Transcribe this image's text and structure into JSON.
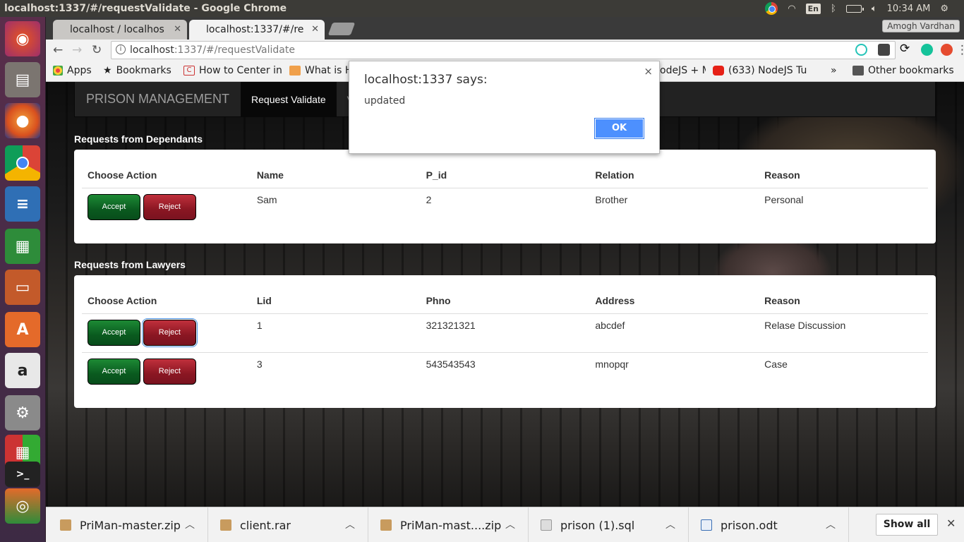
{
  "system": {
    "window_title": "localhost:1337/#/requestValidate - Google Chrome",
    "keyboard": "En",
    "time": "10:34 AM"
  },
  "browser": {
    "tabs": [
      {
        "label": "localhost / localhos"
      },
      {
        "label": "localhost:1337/#/re"
      }
    ],
    "profile": "Amogh Vardhan",
    "url_host": "localhost",
    "url_path": ":1337/#/requestValidate",
    "bookmarks": [
      "Apps",
      "Bookmarks",
      "How to Center in",
      "What is H",
      "odeJS + M",
      "(633) NodeJS Tu"
    ],
    "overflow": "»",
    "other_bookmarks": "Other bookmarks"
  },
  "app": {
    "brand": "PRISON MANAGEMENT",
    "nav": [
      "Request Validate",
      "V"
    ],
    "dependants": {
      "title": "Requests from Dependants",
      "headers": [
        "Choose Action",
        "Name",
        "P_id",
        "Relation",
        "Reason"
      ],
      "rows": [
        [
          "Sam",
          "2",
          "Brother",
          "Personal"
        ]
      ]
    },
    "lawyers": {
      "title": "Requests from Lawyers",
      "headers": [
        "Choose Action",
        "Lid",
        "Phno",
        "Address",
        "Reason"
      ],
      "rows": [
        [
          "1",
          "321321321",
          "abcdef",
          "Relase Discussion"
        ],
        [
          "3",
          "543543543",
          "mnopqr",
          "Case"
        ]
      ]
    },
    "accept_label": "Accept",
    "reject_label": "Reject"
  },
  "alert": {
    "title": "localhost:1337 says:",
    "message": "updated",
    "ok": "OK",
    "close": "×"
  },
  "downloads": {
    "items": [
      "PriMan-master.zip",
      "client.rar",
      "PriMan-mast....zip",
      "prison (1).sql",
      "prison.odt"
    ],
    "show_all": "Show all"
  },
  "colors": {
    "accept": "#0a5a1f",
    "reject": "#8a1622",
    "navbar": "#222222",
    "alert_ok": "#4d90fe"
  }
}
